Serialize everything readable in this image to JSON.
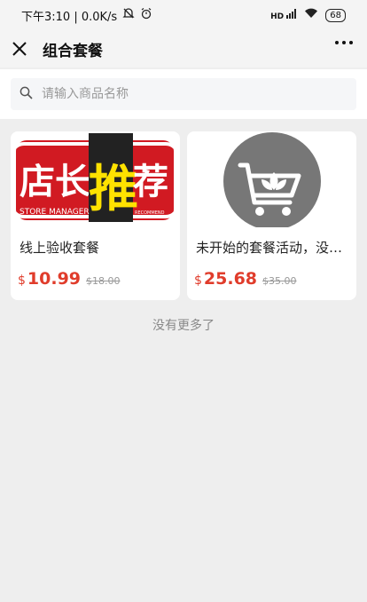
{
  "status": {
    "time_speed": "下午3:10 | 0.0K/s",
    "signal": "HD",
    "battery": "68"
  },
  "nav": {
    "title": "组合套餐"
  },
  "search": {
    "placeholder": "请输入商品名称"
  },
  "products": [
    {
      "name": "线上验收套餐",
      "currency": "$",
      "price": "10.99",
      "original": "$18.00",
      "image_text": {
        "a": "店长",
        "b": "推",
        "c": "荐",
        "en1": "STORE MANAGER",
        "en2": "RECOMMEND"
      }
    },
    {
      "name": "未开始的套餐活动，没有…",
      "currency": "$",
      "price": "25.68",
      "original": "$35.00"
    }
  ],
  "footer": {
    "no_more": "没有更多了"
  },
  "colors": {
    "price_red": "#e03c2b",
    "page_bg": "#eeeeee"
  }
}
